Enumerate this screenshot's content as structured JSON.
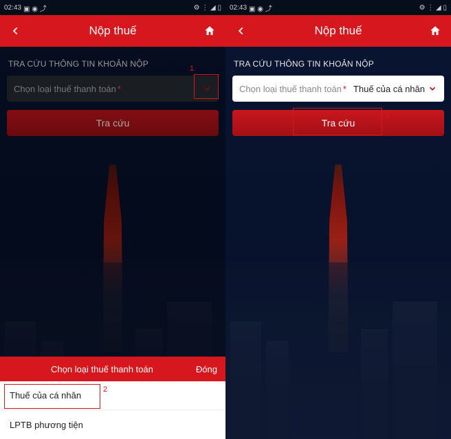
{
  "phone1": {
    "status": {
      "time": "02:43",
      "icons_left": "▣ ◉ ⤴",
      "icons_right": "⚙ ⋮ ◢ ▯"
    },
    "header": {
      "title": "Nộp thuế"
    },
    "section_label": "TRA CỨU THÔNG TIN KHOẢN NỘP",
    "select": {
      "placeholder": "Chọn loại thuế thanh toán",
      "required": "*"
    },
    "search_btn": "Tra cứu",
    "picker": {
      "title": "Chọn loại thuế thanh toán",
      "close": "Đóng",
      "items": [
        "Thuế của cá nhân",
        "LPTB phương tiện"
      ]
    },
    "annotations": {
      "one": "1",
      "two": "2"
    }
  },
  "phone2": {
    "status": {
      "time": "02:43",
      "icons_left": "▣ ◉ ⤴",
      "icons_right": "⚙ ⋮ ◢ ▯"
    },
    "header": {
      "title": "Nộp thuế"
    },
    "section_label": "TRA CỨU THÔNG TIN KHOẢN NỘP",
    "select": {
      "placeholder": "Chọn loại thuế thanh toán",
      "required": "*",
      "value": "Thuế của cá nhân"
    },
    "search_btn": "Tra cứu",
    "annotations": {
      "three": "3"
    }
  }
}
